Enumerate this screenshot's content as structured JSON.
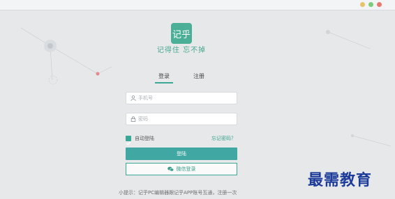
{
  "app": {
    "logo_text": "记乎",
    "slogan": "记得住 忘不掉"
  },
  "tabs": [
    {
      "label": "登录",
      "active": true
    },
    {
      "label": "注册",
      "active": false
    }
  ],
  "form": {
    "phone_placeholder": "手机号",
    "password_placeholder": "密码",
    "remember_label": "自动登陆",
    "remember_checked": true,
    "forgot_label": "忘记密码？",
    "login_label": "登陆",
    "wechat_label": "微信登录"
  },
  "tip": "小提示：记乎PC编辑器跟记乎APP账号互通，注册一次",
  "watermark": "最需教育",
  "colors": {
    "accent": "#3ba895",
    "button": "#40a7a2",
    "background": "#e6e8ea",
    "watermark": "#1d3c9a"
  }
}
